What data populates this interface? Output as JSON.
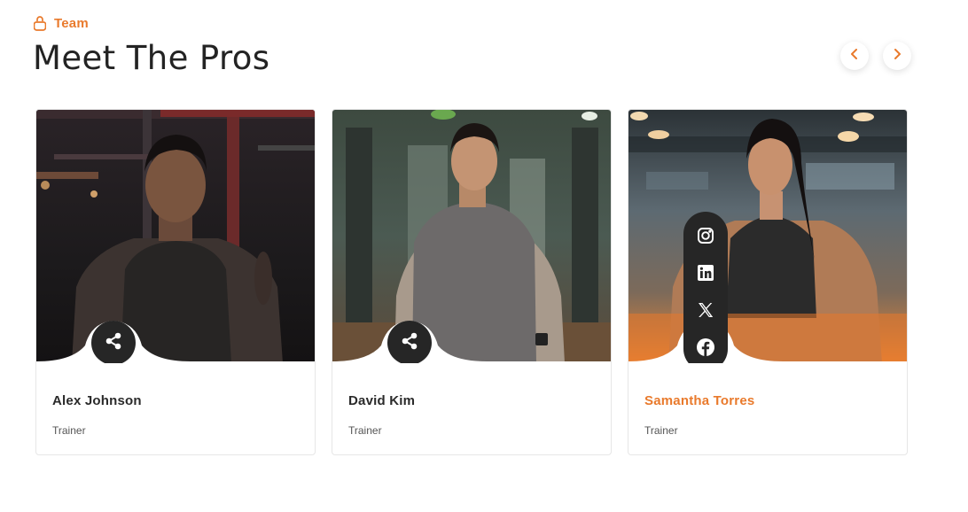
{
  "header": {
    "eyebrow_icon": "kettlebell-icon",
    "eyebrow": "Team",
    "title": "Meet The Pros",
    "accent_color": "#e97a2c"
  },
  "carousel": {
    "prev_icon": "chevron-left-icon",
    "next_icon": "chevron-right-icon"
  },
  "team": [
    {
      "name": "Alex Johnson",
      "role": "Trainer",
      "share_icon": "share-icon"
    },
    {
      "name": "David Kim",
      "role": "Trainer",
      "share_icon": "share-icon"
    },
    {
      "name": "Samantha Torres",
      "role": "Trainer",
      "social_icons": [
        "instagram-icon",
        "linkedin-icon",
        "x-icon",
        "facebook-icon"
      ]
    }
  ]
}
